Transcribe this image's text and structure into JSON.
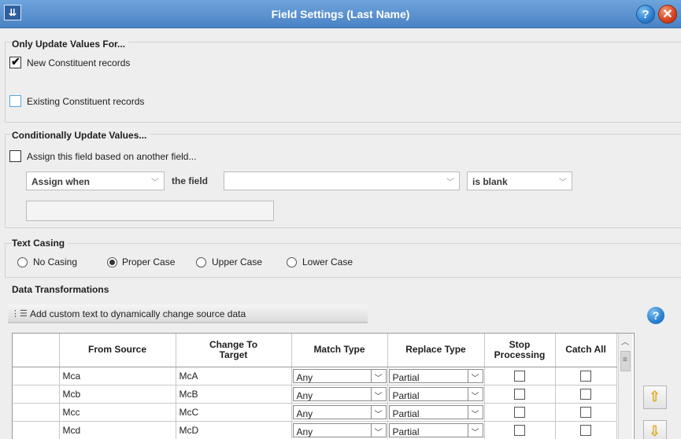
{
  "window": {
    "title": "Field Settings (Last Name)",
    "app_icon": "field-settings-icon",
    "help_glyph": "?",
    "close_glyph": "✕"
  },
  "only_update": {
    "title": "Only Update Values For...",
    "options": [
      {
        "label": "New Constituent records",
        "checked": true
      },
      {
        "label": "Existing Constituent records",
        "checked": false
      }
    ]
  },
  "conditional": {
    "title": "Conditionally Update Values...",
    "assign_checkbox_label": "Assign this field based on another field...",
    "assign_when": "Assign when",
    "the_field_label": "the field",
    "field_value": "",
    "condition": "is blank",
    "value_text": ""
  },
  "text_casing": {
    "title": "Text Casing",
    "options": [
      "No Casing",
      "Proper Case",
      "Upper Case",
      "Lower Case"
    ],
    "selected": "Proper Case"
  },
  "data_transformations": {
    "title": "Data Transformations",
    "custom_text_button": "Add custom text to dynamically change source data",
    "help_glyph": "?",
    "columns": [
      "From Source",
      "Change To Target",
      "Match Type",
      "Replace Type",
      "Stop Processing",
      "Catch All"
    ],
    "rows": [
      {
        "from": "Mca",
        "to": "McA",
        "match": "Any",
        "replace": "Partial",
        "stop": false,
        "catch_all": false
      },
      {
        "from": "Mcb",
        "to": "McB",
        "match": "Any",
        "replace": "Partial",
        "stop": false,
        "catch_all": false
      },
      {
        "from": "Mcc",
        "to": "McC",
        "match": "Any",
        "replace": "Partial",
        "stop": false,
        "catch_all": false
      },
      {
        "from": "Mcd",
        "to": "McD",
        "match": "Any",
        "replace": "Partial",
        "stop": false,
        "catch_all": false
      }
    ],
    "move_up_icon": "arrow-up-icon",
    "move_down_icon": "arrow-down-icon"
  }
}
